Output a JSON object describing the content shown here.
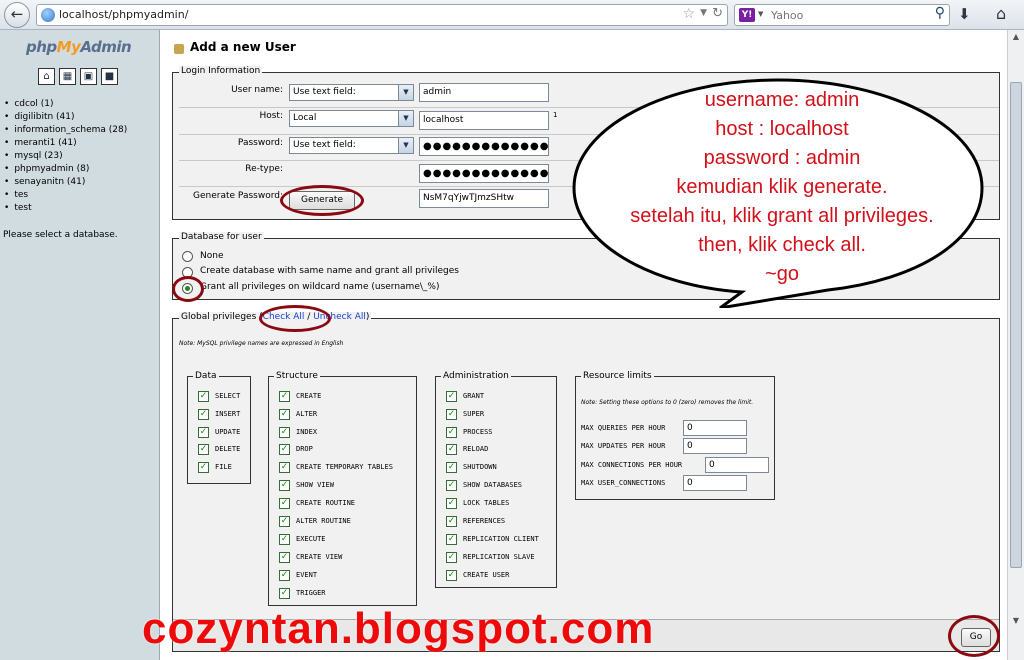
{
  "browser": {
    "url": "localhost/phpmyadmin/",
    "search_engine": "Yahoo",
    "search_logo": "Y!"
  },
  "sidebar": {
    "logo_part1": "php",
    "logo_part2": "My",
    "logo_part3": "Admin",
    "databases": [
      "cdcol (1)",
      "digilibitn (41)",
      "information_schema (28)",
      "meranti1 (41)",
      "mysql (23)",
      "phpmyadmin (8)",
      "senayanitn (41)",
      "tes",
      "test"
    ],
    "hint": "Please select a database."
  },
  "page": {
    "title": "Add a new User"
  },
  "login": {
    "legend": "Login Information",
    "username_label": "User name:",
    "username_mode": "Use text field:",
    "username_value": "admin",
    "host_label": "Host:",
    "host_mode": "Local",
    "host_value": "localhost",
    "host_footnote": "1",
    "password_label": "Password:",
    "password_mode": "Use text field:",
    "password_value": "●●●●●●●●●●●●●●●●",
    "retype_label": "Re-type:",
    "retype_value": "●●●●●●●●●●●●●●●●",
    "generate_label": "Generate Password:",
    "generate_button": "Generate",
    "generated_value": "NsM7qYjwTJmzSHtw"
  },
  "database_for_user": {
    "legend": "Database for user",
    "options": [
      "None",
      "Create database with same name and grant all privileges",
      "Grant all privileges on wildcard name (username\\_%)"
    ],
    "selected": 2
  },
  "global": {
    "legend_prefix": "Global privileges",
    "check_all": "Check All",
    "separator": "/",
    "uncheck_all": "Uncheck All",
    "note": "Note: MySQL privilege names are expressed in English",
    "data_legend": "Data",
    "data": [
      "SELECT",
      "INSERT",
      "UPDATE",
      "DELETE",
      "FILE"
    ],
    "structure_legend": "Structure",
    "structure": [
      "CREATE",
      "ALTER",
      "INDEX",
      "DROP",
      "CREATE TEMPORARY TABLES",
      "SHOW VIEW",
      "CREATE ROUTINE",
      "ALTER ROUTINE",
      "EXECUTE",
      "CREATE VIEW",
      "EVENT",
      "TRIGGER"
    ],
    "admin_legend": "Administration",
    "admin": [
      "GRANT",
      "SUPER",
      "PROCESS",
      "RELOAD",
      "SHUTDOWN",
      "SHOW DATABASES",
      "LOCK TABLES",
      "REFERENCES",
      "REPLICATION CLIENT",
      "REPLICATION SLAVE",
      "CREATE USER"
    ],
    "limits_legend": "Resource limits",
    "limits_note": "Note: Setting these options to 0 (zero) removes the limit.",
    "limits": [
      {
        "label": "MAX QUERIES PER HOUR",
        "value": "0"
      },
      {
        "label": "MAX UPDATES PER HOUR",
        "value": "0"
      },
      {
        "label": "MAX CONNECTIONS PER HOUR",
        "value": "0"
      },
      {
        "label": "MAX USER_CONNECTIONS",
        "value": "0"
      }
    ],
    "go_button": "Go"
  },
  "annotation": {
    "lines": [
      "username: admin",
      "host : localhost",
      "password : admin",
      "kemudian klik generate.",
      "setelah itu, klik grant all privileges.",
      "then, klik check all.",
      "~go"
    ],
    "color": "#d2101a",
    "watermark": "cozyntan.blogspot.com"
  }
}
